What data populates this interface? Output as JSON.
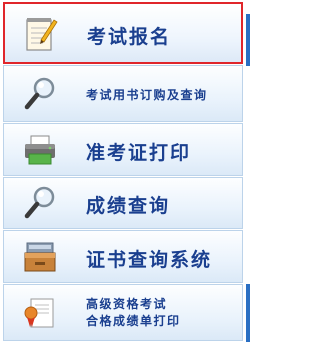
{
  "menu": {
    "items": [
      {
        "label": "考试报名",
        "icon": "notepad-pencil-icon",
        "active": true
      },
      {
        "label": "考试用书订购及查询",
        "icon": "magnifier-icon"
      },
      {
        "label": "准考证打印",
        "icon": "printer-icon"
      },
      {
        "label": "成绩查询",
        "icon": "magnifier-icon"
      },
      {
        "label": "证书查询系统",
        "icon": "archive-box-icon"
      },
      {
        "label_line1": "高级资格考试",
        "label_line2": "合格成绩单打印",
        "icon": "certificate-icon"
      }
    ]
  },
  "colors": {
    "label": "#1a3f8f",
    "active_border": "#e0262b",
    "item_border": "#bcd3ea",
    "accent_edge": "#2a6fc3"
  }
}
